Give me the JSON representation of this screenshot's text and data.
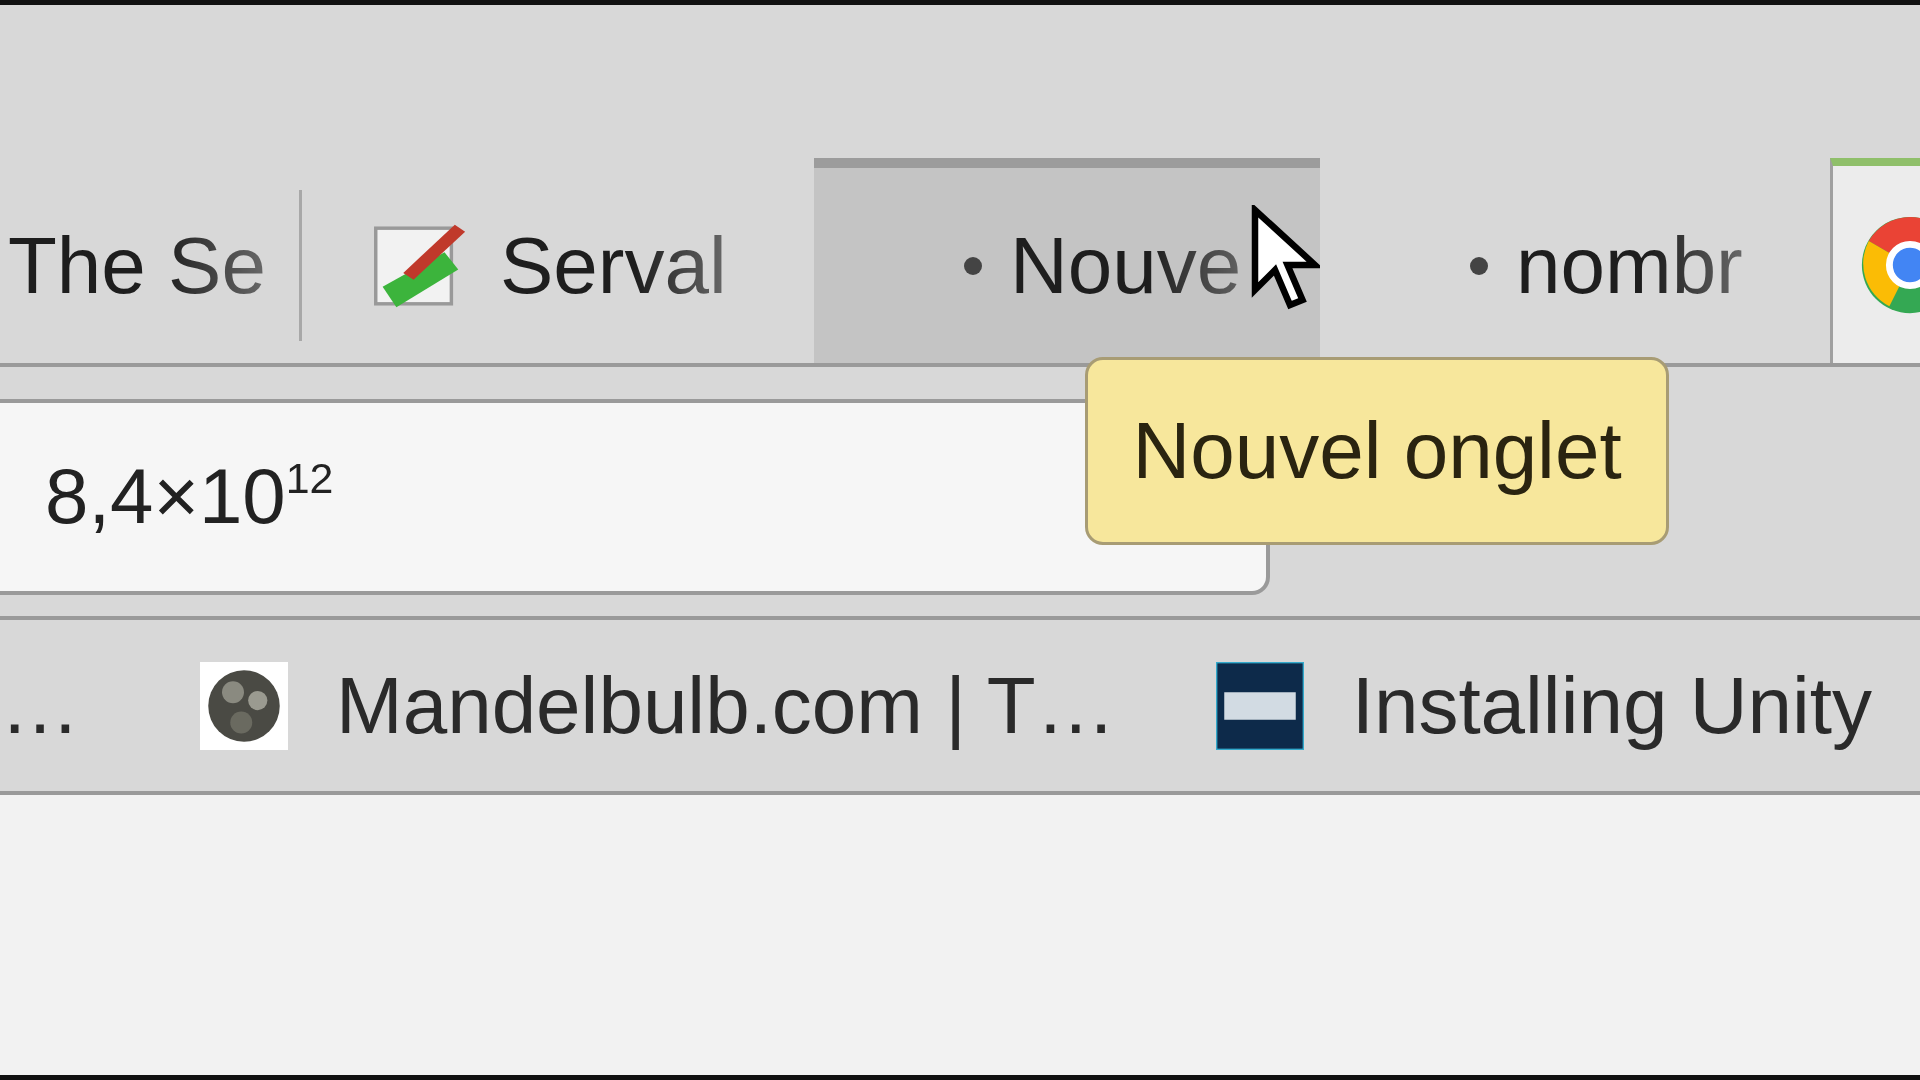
{
  "tabs": [
    {
      "title": "The Se",
      "kind": "plain",
      "selected": false,
      "hovered": false
    },
    {
      "title": "Serval",
      "kind": "favicon",
      "selected": false,
      "hovered": false
    },
    {
      "title": "Nouve",
      "kind": "attention",
      "selected": false,
      "hovered": true
    },
    {
      "title": "nombr",
      "kind": "attention",
      "selected": false,
      "hovered": false
    },
    {
      "kind": "favicon",
      "selected": true,
      "hovered": false
    }
  ],
  "tooltip": {
    "text": "Nouvel onglet"
  },
  "address_bar": {
    "value": "8,4×10$^{12}$"
  },
  "bookmarks": [
    {
      "title": "…",
      "kind": "plain"
    },
    {
      "title": "Mandelbulb.com | T…",
      "kind": "favicon"
    },
    {
      "title": "Installing Unity",
      "kind": "favicon"
    }
  ]
}
